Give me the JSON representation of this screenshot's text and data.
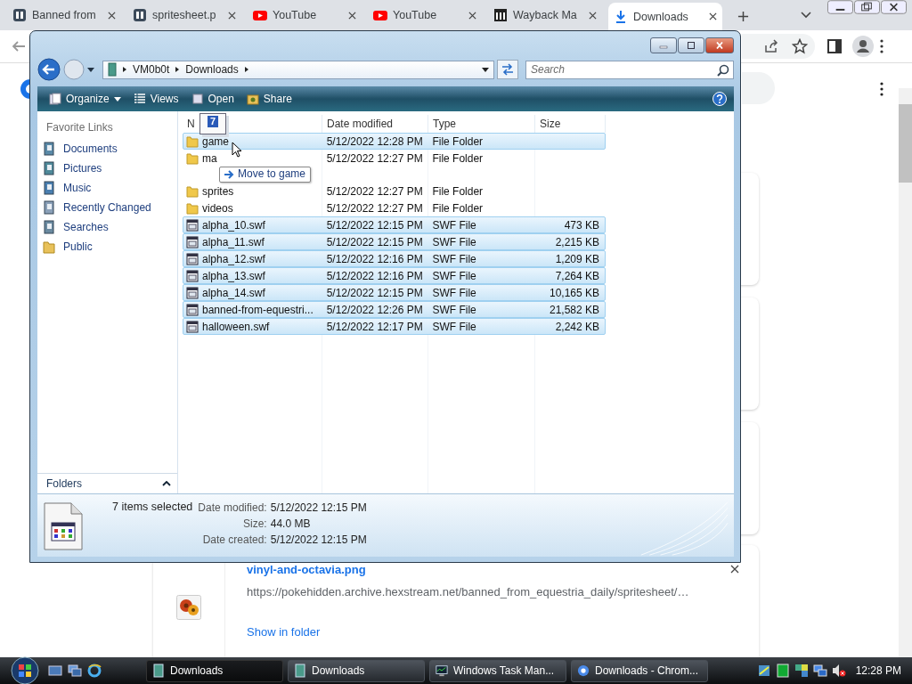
{
  "browser": {
    "tabs": [
      {
        "title": "Banned from",
        "kind": "ph",
        "selected": false
      },
      {
        "title": "spritesheet.p",
        "kind": "ph",
        "selected": false
      },
      {
        "title": "YouTube",
        "kind": "youtube",
        "selected": false
      },
      {
        "title": "YouTube",
        "kind": "youtube",
        "selected": false
      },
      {
        "title": "Wayback Ma",
        "kind": "archive",
        "selected": false
      },
      {
        "title": "Downloads",
        "kind": "download",
        "selected": true
      }
    ],
    "download": {
      "filename": "vinyl-and-octavia.png",
      "url": "https://pokehidden.archive.hexstream.net/banned_from_equestria_daily/spritesheet/…",
      "action": "Show in folder"
    }
  },
  "explorer": {
    "crumbs": [
      "VM0b0t",
      "Downloads"
    ],
    "search_placeholder": "Search",
    "toolbar": [
      {
        "label": "Organize",
        "kind": "menu"
      },
      {
        "label": "Views",
        "kind": "views"
      },
      {
        "label": "Open",
        "kind": "open"
      },
      {
        "label": "Share",
        "kind": "share"
      }
    ],
    "favorites_title": "Favorite Links",
    "favorites": [
      {
        "label": "Documents",
        "kind": "documents"
      },
      {
        "label": "Pictures",
        "kind": "pictures"
      },
      {
        "label": "Music",
        "kind": "music"
      },
      {
        "label": "Recently Changed",
        "kind": "recent"
      },
      {
        "label": "Searches",
        "kind": "searches"
      },
      {
        "label": "Public",
        "kind": "folder"
      }
    ],
    "folders_label": "Folders",
    "columns": [
      "N",
      "Date modified",
      "Type",
      "Size"
    ],
    "rows": [
      {
        "name": "game",
        "date": "5/12/2022 12:28 PM",
        "type": "File Folder",
        "kind": "folder",
        "selected": true
      },
      {
        "name": "ma",
        "date": "5/12/2022 12:27 PM",
        "type": "File Folder",
        "kind": "folder",
        "selected": false
      },
      {
        "name": "sprites",
        "date": "5/12/2022 12:27 PM",
        "type": "File Folder",
        "kind": "folder",
        "selected": false
      },
      {
        "name": "videos",
        "date": "5/12/2022 12:27 PM",
        "type": "File Folder",
        "kind": "folder",
        "selected": false
      },
      {
        "name": "alpha_10.swf",
        "date": "5/12/2022 12:15 PM",
        "type": "SWF File",
        "size": "473 KB",
        "kind": "file",
        "selected": true
      },
      {
        "name": "alpha_11.swf",
        "date": "5/12/2022 12:15 PM",
        "type": "SWF File",
        "size": "2,215 KB",
        "kind": "file",
        "selected": true
      },
      {
        "name": "alpha_12.swf",
        "date": "5/12/2022 12:16 PM",
        "type": "SWF File",
        "size": "1,209 KB",
        "kind": "file",
        "selected": true
      },
      {
        "name": "alpha_13.swf",
        "date": "5/12/2022 12:16 PM",
        "type": "SWF File",
        "size": "7,264 KB",
        "kind": "file",
        "selected": true
      },
      {
        "name": "alpha_14.swf",
        "date": "5/12/2022 12:15 PM",
        "type": "SWF File",
        "size": "10,165 KB",
        "kind": "file",
        "selected": true
      },
      {
        "name": "banned-from-equestri...",
        "date": "5/12/2022 12:26 PM",
        "type": "SWF File",
        "size": "21,582 KB",
        "kind": "file",
        "selected": true
      },
      {
        "name": "halloween.swf",
        "date": "5/12/2022 12:17 PM",
        "type": "SWF File",
        "size": "2,242 KB",
        "kind": "file",
        "selected": true
      }
    ],
    "drag": {
      "count": "7",
      "tooltip": "Move to game"
    },
    "details": {
      "summary": "7 items selected",
      "fields": [
        {
          "label": "Date modified:",
          "value": "5/12/2022 12:15 PM"
        },
        {
          "label": "Size:",
          "value": "44.0 MB"
        },
        {
          "label": "Date created:",
          "value": "5/12/2022 12:15 PM"
        }
      ]
    }
  },
  "taskbar": {
    "buttons": [
      {
        "label": "Downloads",
        "kind": "explorer",
        "selected": true
      },
      {
        "label": "Downloads",
        "kind": "explorer",
        "selected": false
      },
      {
        "label": "Windows Task Man...",
        "kind": "taskmgr",
        "selected": false
      },
      {
        "label": "Downloads - Chrom...",
        "kind": "chrome",
        "selected": false
      }
    ],
    "clock": "12:28 PM"
  }
}
